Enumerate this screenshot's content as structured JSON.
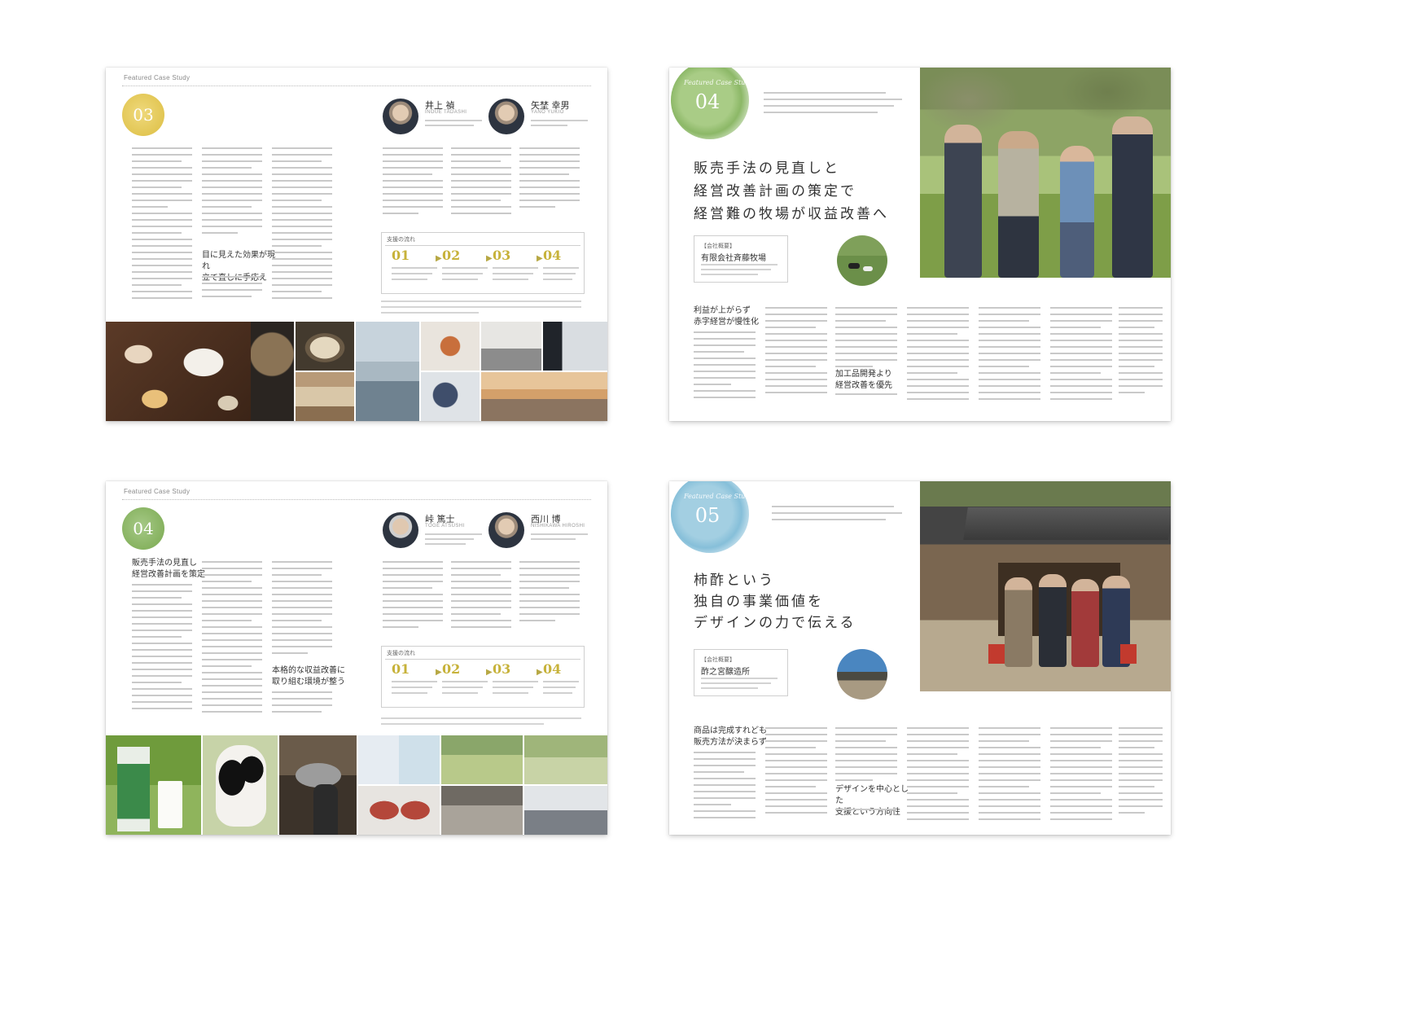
{
  "spreads": {
    "s03": {
      "header": "Featured Case Study",
      "number": "03",
      "persons": [
        {
          "name": "井上 禎",
          "romaji": "INOUE TADASHI"
        },
        {
          "name": "矢埜 幸男",
          "romaji": "YANO YUKIO"
        }
      ],
      "subheading": "目に見えた効果が現れ\n立て直しに手応え",
      "flow_title": "支援の流れ",
      "steps": [
        "01",
        "02",
        "03",
        "04"
      ]
    },
    "s04r": {
      "header": "Featured Case Study",
      "number": "04",
      "headline": [
        "販売手法の見直しと",
        "経営改善計画の策定で",
        "経営難の牧場が収益改善へ"
      ],
      "company_tag": "【会社概要】",
      "company_name": "有限会社斉藤牧場",
      "sub1": "利益が上がらず\n赤字経営が慢性化",
      "sub2": "加工品開発より\n経営改善を優先"
    },
    "s04l": {
      "header": "Featured Case Study",
      "number": "04",
      "persons": [
        {
          "name": "峠 篤士",
          "romaji": "TOGE ATSUSHI"
        },
        {
          "name": "西川 博",
          "romaji": "NISHIKAWA HIROSHI"
        }
      ],
      "sub1": "販売手法の見直し\n経営改善計画を策定",
      "sub2": "本格的な収益改善に\n取り組む環境が整う",
      "flow_title": "支援の流れ",
      "steps": [
        "01",
        "02",
        "03",
        "04"
      ]
    },
    "s05": {
      "header": "Featured Case Study",
      "number": "05",
      "headline": [
        "柿酢という",
        "独自の事業価値を",
        "デザインの力で伝える"
      ],
      "company_tag": "【会社概要】",
      "company_name": "酢之宮醸造所",
      "sub1": "商品は完成すれども\n販売方法が決まらず",
      "sub2": "デザインを中心とした\n支援という方向性"
    }
  },
  "colors": {
    "yellow": "#e7cf63",
    "green": "#8fbb6a",
    "blue": "#8fc3dc",
    "step_gold": "#c7b23a"
  }
}
